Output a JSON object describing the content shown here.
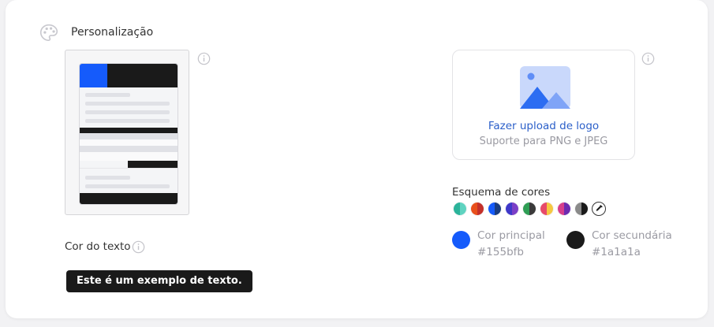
{
  "section": {
    "title": "Personalização",
    "icon": "palette-icon"
  },
  "preview": {
    "accent": "#155bfb",
    "dark": "#1a1a1a"
  },
  "text_color": {
    "label": "Cor do texto",
    "sample": "Este é um exemplo de texto."
  },
  "logo_upload": {
    "action": "Fazer upload de logo",
    "hint": "Suporte para PNG e JPEG",
    "icon": "image-icon"
  },
  "color_scheme": {
    "label": "Esquema de cores",
    "swatches": [
      {
        "left": "#2bb39a",
        "right": "#5fd3c0"
      },
      {
        "left": "#e8501c",
        "right": "#c4302a"
      },
      {
        "left": "#155bfb",
        "right": "#1a3d80"
      },
      {
        "left": "#3f38c9",
        "right": "#7b3fc6"
      },
      {
        "left": "#2f9e55",
        "right": "#3a3a3a"
      },
      {
        "left": "#e74a6a",
        "right": "#f5c842"
      },
      {
        "left": "#d63f8c",
        "right": "#6c2bb0"
      },
      {
        "left": "#8a8a8a",
        "right": "#1a1a1a"
      }
    ],
    "picker_icon": "eyedropper-icon"
  },
  "primary_color": {
    "label": "Cor principal",
    "hex": "#155bfb",
    "value": "#155bfb"
  },
  "secondary_color": {
    "label": "Cor secundária",
    "hex": "#1a1a1a",
    "value": "#1a1a1a"
  },
  "info_icon": "info-icon"
}
